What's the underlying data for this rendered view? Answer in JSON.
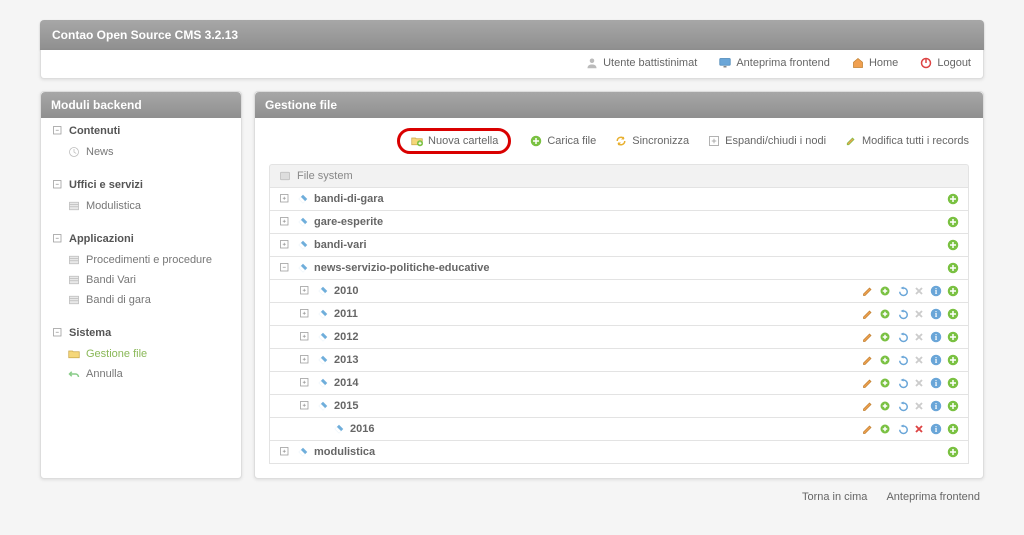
{
  "app_title": "Contao Open Source CMS 3.2.13",
  "topbar": {
    "user": "Utente battistinimat",
    "preview": "Anteprima frontend",
    "home": "Home",
    "logout": "Logout"
  },
  "sidebar": {
    "title": "Moduli backend",
    "sections": [
      {
        "label": "Contenuti",
        "items": [
          {
            "label": "News",
            "icon": "clock-icon",
            "active": false
          }
        ]
      },
      {
        "label": "Uffici e servizi",
        "items": [
          {
            "label": "Modulistica",
            "icon": "module-icon",
            "active": false
          }
        ]
      },
      {
        "label": "Applicazioni",
        "items": [
          {
            "label": "Procedimenti e procedure",
            "icon": "module-icon",
            "active": false
          },
          {
            "label": "Bandi Vari",
            "icon": "module-icon",
            "active": false
          },
          {
            "label": "Bandi di gara",
            "icon": "module-icon",
            "active": false
          }
        ]
      },
      {
        "label": "Sistema",
        "items": [
          {
            "label": "Gestione file",
            "icon": "folder-icon",
            "active": true
          },
          {
            "label": "Annulla",
            "icon": "undo-icon",
            "active": false
          }
        ]
      }
    ]
  },
  "main": {
    "title": "Gestione file",
    "actions": {
      "new_folder": "Nuova cartella",
      "upload": "Carica file",
      "sync": "Sincronizza",
      "toggle": "Espandi/chiudi i nodi",
      "edit_all": "Modifica tutti i records"
    },
    "filesystem_label": "File system",
    "tree": [
      {
        "label": "bandi-di-gara",
        "depth": 0,
        "ops": "add"
      },
      {
        "label": "gare-esperite",
        "depth": 0,
        "ops": "add"
      },
      {
        "label": "bandi-vari",
        "depth": 0,
        "ops": "add"
      },
      {
        "label": "news-servizio-politiche-educative",
        "depth": 0,
        "ops": "add",
        "expanded": true
      },
      {
        "label": "2010",
        "depth": 1,
        "ops": "full"
      },
      {
        "label": "2011",
        "depth": 1,
        "ops": "full"
      },
      {
        "label": "2012",
        "depth": 1,
        "ops": "full"
      },
      {
        "label": "2013",
        "depth": 1,
        "ops": "full"
      },
      {
        "label": "2014",
        "depth": 1,
        "ops": "full"
      },
      {
        "label": "2015",
        "depth": 1,
        "ops": "full"
      },
      {
        "label": "2016",
        "depth": 2,
        "ops": "full-del"
      },
      {
        "label": "modulistica",
        "depth": 0,
        "ops": "add"
      }
    ]
  },
  "footer": {
    "back_to_top": "Torna in cima",
    "preview": "Anteprima frontend"
  }
}
